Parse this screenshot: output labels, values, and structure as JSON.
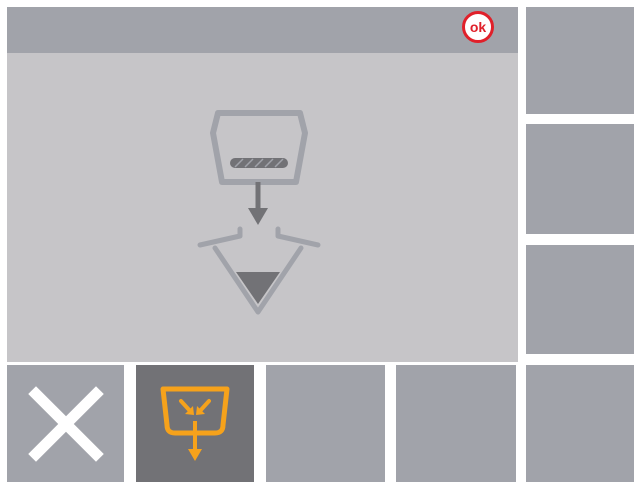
{
  "header": {
    "ok_label": "ok"
  },
  "main": {
    "illustration_icon": "fill-portafilter-to-grinder-icon"
  },
  "side_buttons": [
    {
      "icon": ""
    },
    {
      "icon": ""
    },
    {
      "icon": ""
    },
    {
      "icon": ""
    }
  ],
  "bottom_buttons": [
    {
      "icon": "close-icon"
    },
    {
      "icon": "grounds-bin-empty-icon",
      "active": true
    },
    {
      "icon": ""
    },
    {
      "icon": ""
    }
  ],
  "colors": {
    "panel_bg": "#c6c5c8",
    "button_bg": "#a1a3aa",
    "button_active_bg": "#727276",
    "ok_red": "#e0202a",
    "accent_orange": "#f6a21b",
    "icon_gray": "#727276",
    "icon_light_gray": "#a1a3aa",
    "white": "#ffffff"
  }
}
